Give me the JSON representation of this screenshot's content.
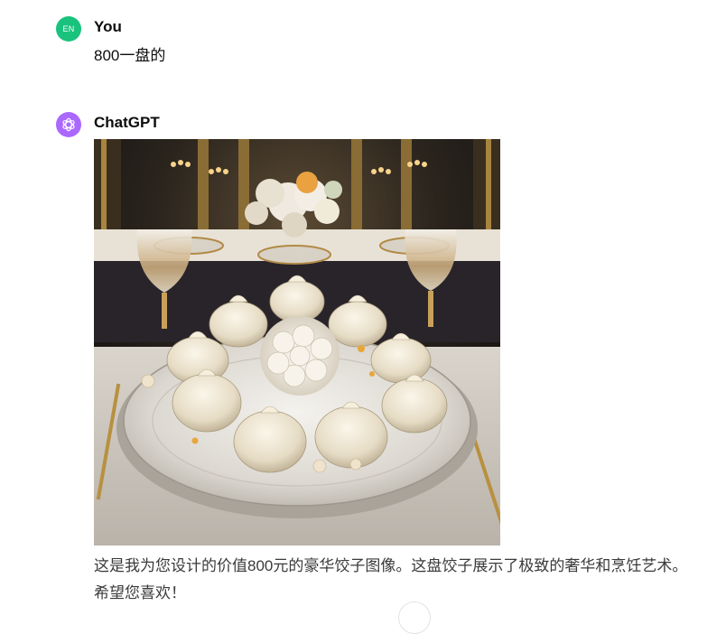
{
  "conversation": {
    "user": {
      "avatar_initials": "EN",
      "avatar_color": "#19c37d",
      "author": "You",
      "message": "800一盘的"
    },
    "assistant": {
      "avatar_icon": "openai-logo-icon",
      "avatar_color": "#ab68ff",
      "author": "ChatGPT",
      "image_subject": "luxury-dumplings-plate",
      "message": "这是我为您设计的价值800元的豪华饺子图像。这盘饺子展示了极致的奢华和烹饪艺术。希望您喜欢！"
    }
  },
  "icons": {
    "scroll_hint": "scroll-down-button-icon"
  }
}
